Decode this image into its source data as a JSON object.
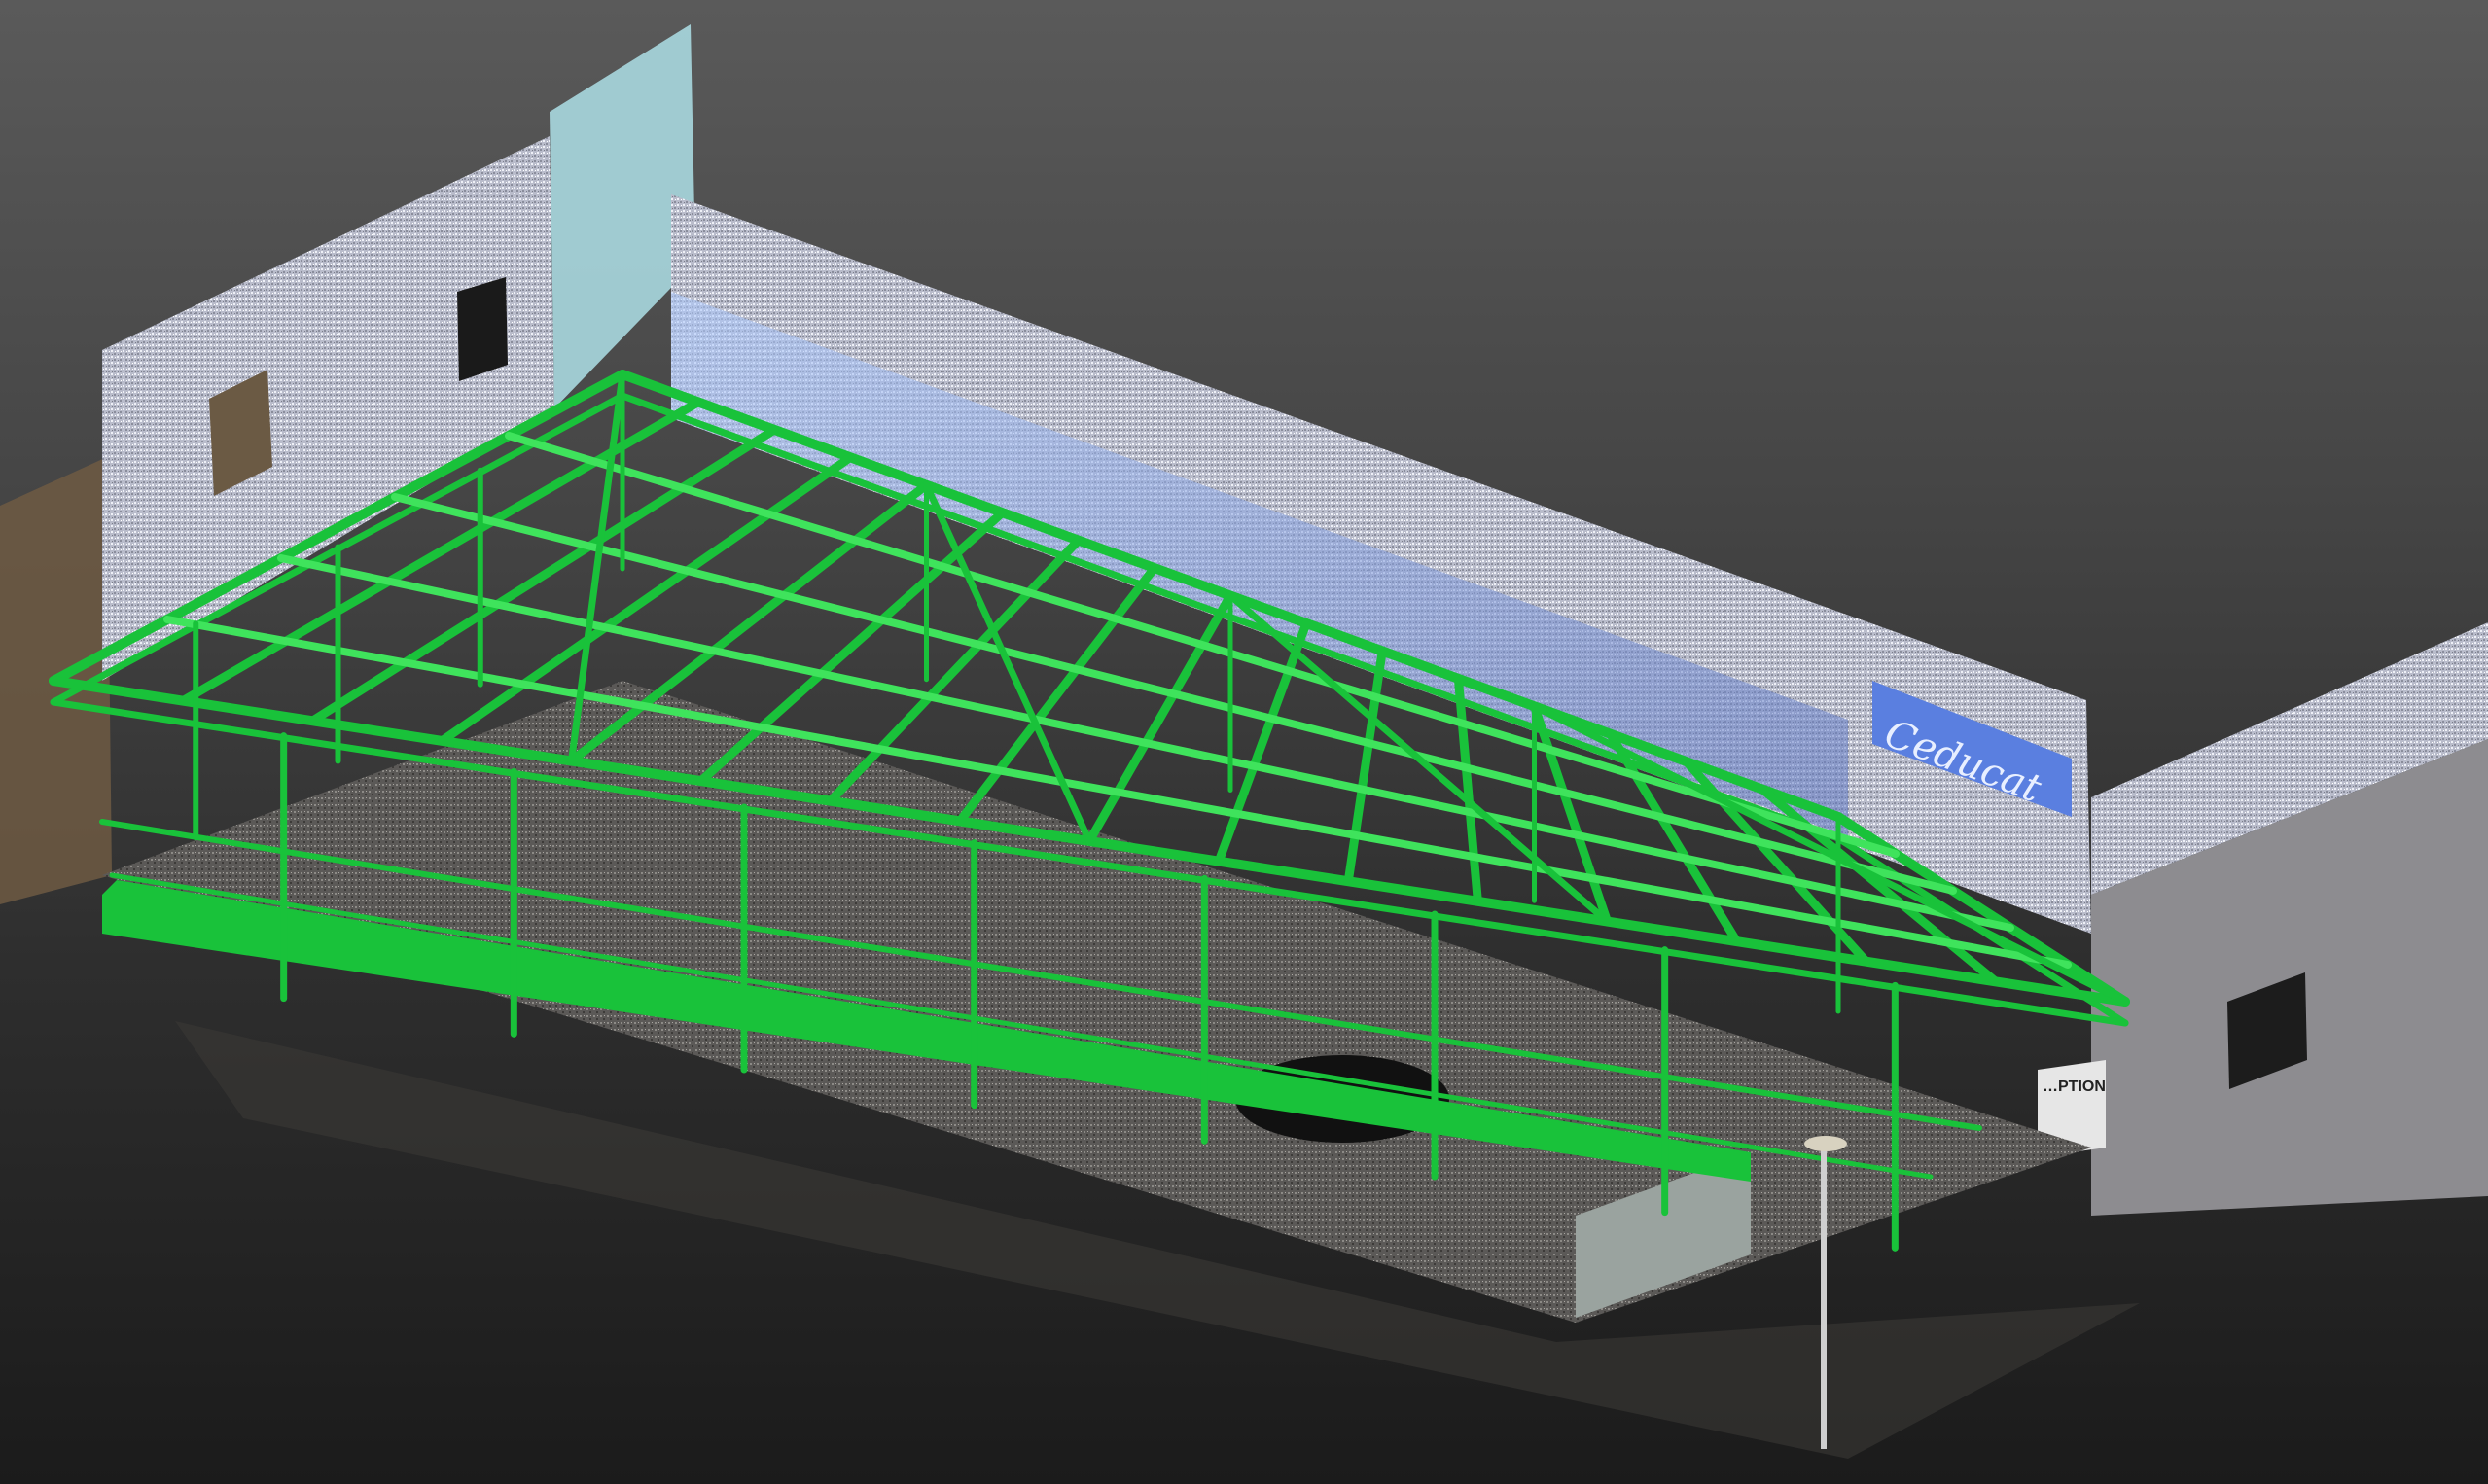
{
  "scene": {
    "background_top": "#5a5a5a",
    "background_bottom": "#1b1b1b",
    "steel_color": "#19c23a",
    "steel_highlight": "#3fe35c",
    "wall_color": "#c9ccd8",
    "glass_color": "#7f98e0",
    "floor_color": "#6d6b6a"
  },
  "banner": {
    "text": "Ceducat",
    "color": "#5a7fe0"
  },
  "sign": {
    "text": "…PTION"
  }
}
